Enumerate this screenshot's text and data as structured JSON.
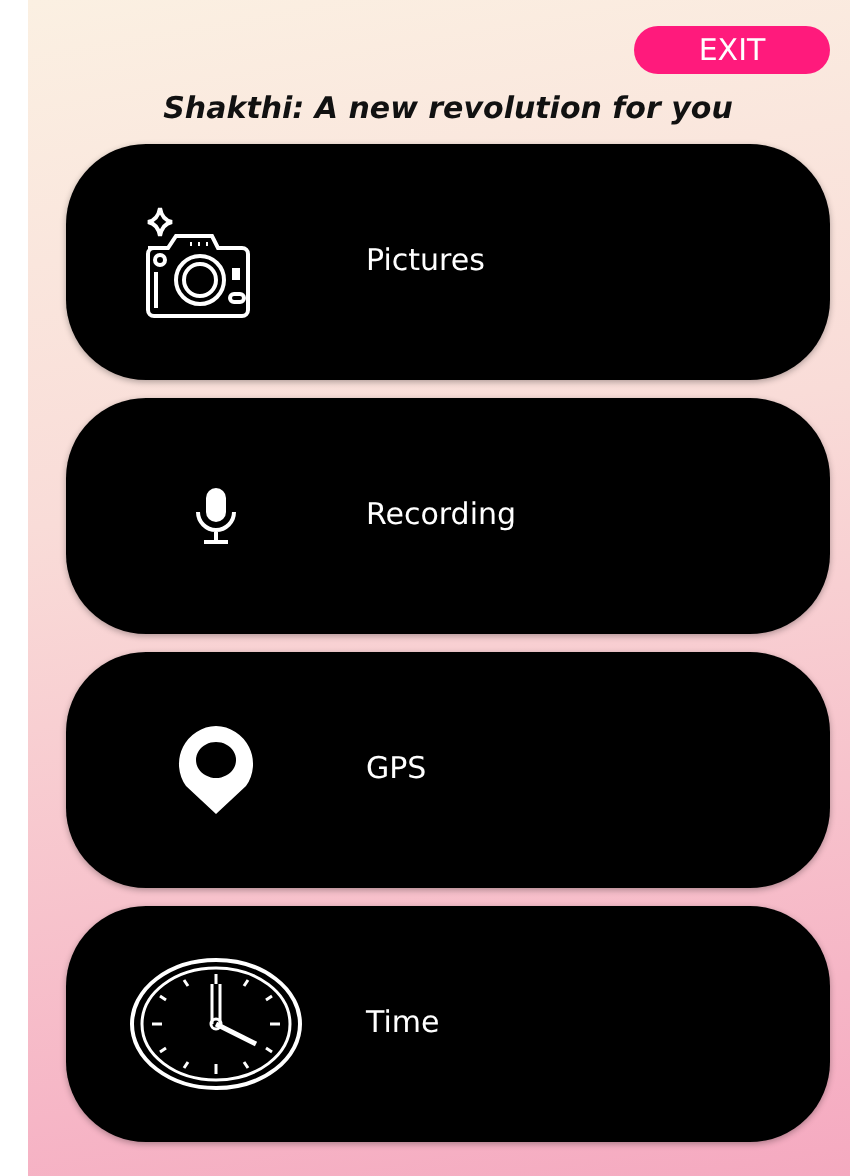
{
  "exit_button": "EXIT",
  "title": "Shakthi: A new revolution for you",
  "menu_items": [
    {
      "label": "Pictures",
      "kind": "camera"
    },
    {
      "label": "Recording",
      "kind": "microphone"
    },
    {
      "label": "GPS",
      "kind": "location"
    },
    {
      "label": "Time",
      "kind": "clock"
    }
  ]
}
